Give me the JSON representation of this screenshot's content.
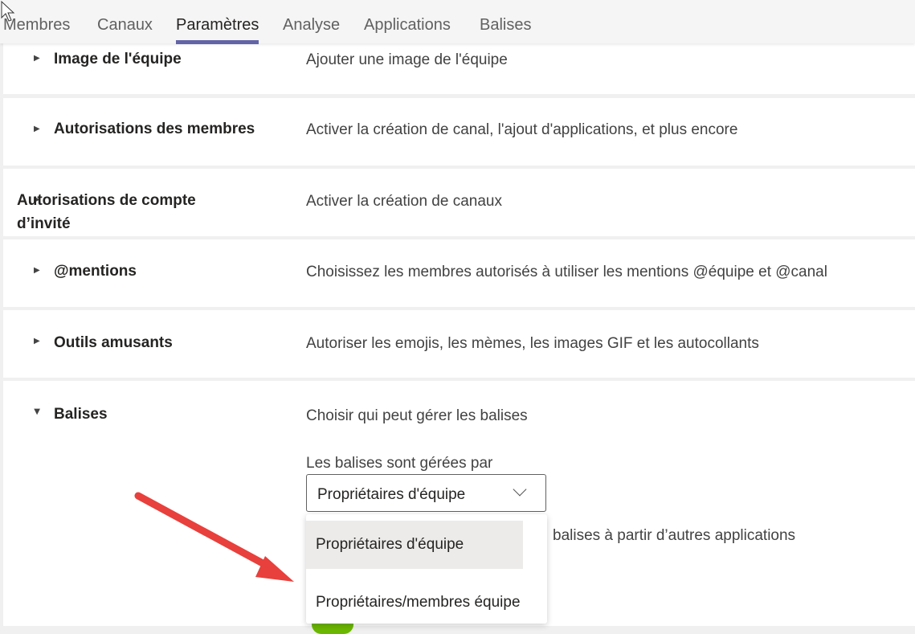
{
  "tabs": [
    {
      "label": "Membres"
    },
    {
      "label": "Canaux"
    },
    {
      "label": "Paramètres",
      "active": true
    },
    {
      "label": "Analyse"
    },
    {
      "label": "Applications"
    },
    {
      "label": "Balises"
    }
  ],
  "sections": [
    {
      "title": "Image de l'équipe",
      "description": "Ajouter une image de l'équipe",
      "expanded": false
    },
    {
      "title": "Autorisations des membres",
      "description": "Activer la création de canal, l'ajout d'applications, et plus encore",
      "expanded": false
    },
    {
      "title": "Autorisations de compte d’invité",
      "description": "Activer la création de canaux",
      "expanded": false
    },
    {
      "title": "@mentions",
      "description": "Choisissez les membres autorisés à utiliser les mentions @équipe et @canal",
      "expanded": false
    },
    {
      "title": "Outils amusants",
      "description": "Autoriser les emojis, les mèmes, les images GIF et les autocollants",
      "expanded": false
    },
    {
      "title": "Balises",
      "description": "Choisir qui peut gérer les balises",
      "expanded": true
    }
  ],
  "tags": {
    "managed_by_label": "Les balises sont gérées par",
    "selected": "Propriétaires d'équipe",
    "options": [
      "Propriétaires d'équipe",
      "Propriétaires/membres équipe"
    ],
    "partial_text": "balises à partir d’autres applications",
    "toggle_on": true,
    "toggle_color": "#6bb700"
  },
  "colors": {
    "accent": "#6264a7",
    "annotation_arrow": "#e8403c"
  }
}
